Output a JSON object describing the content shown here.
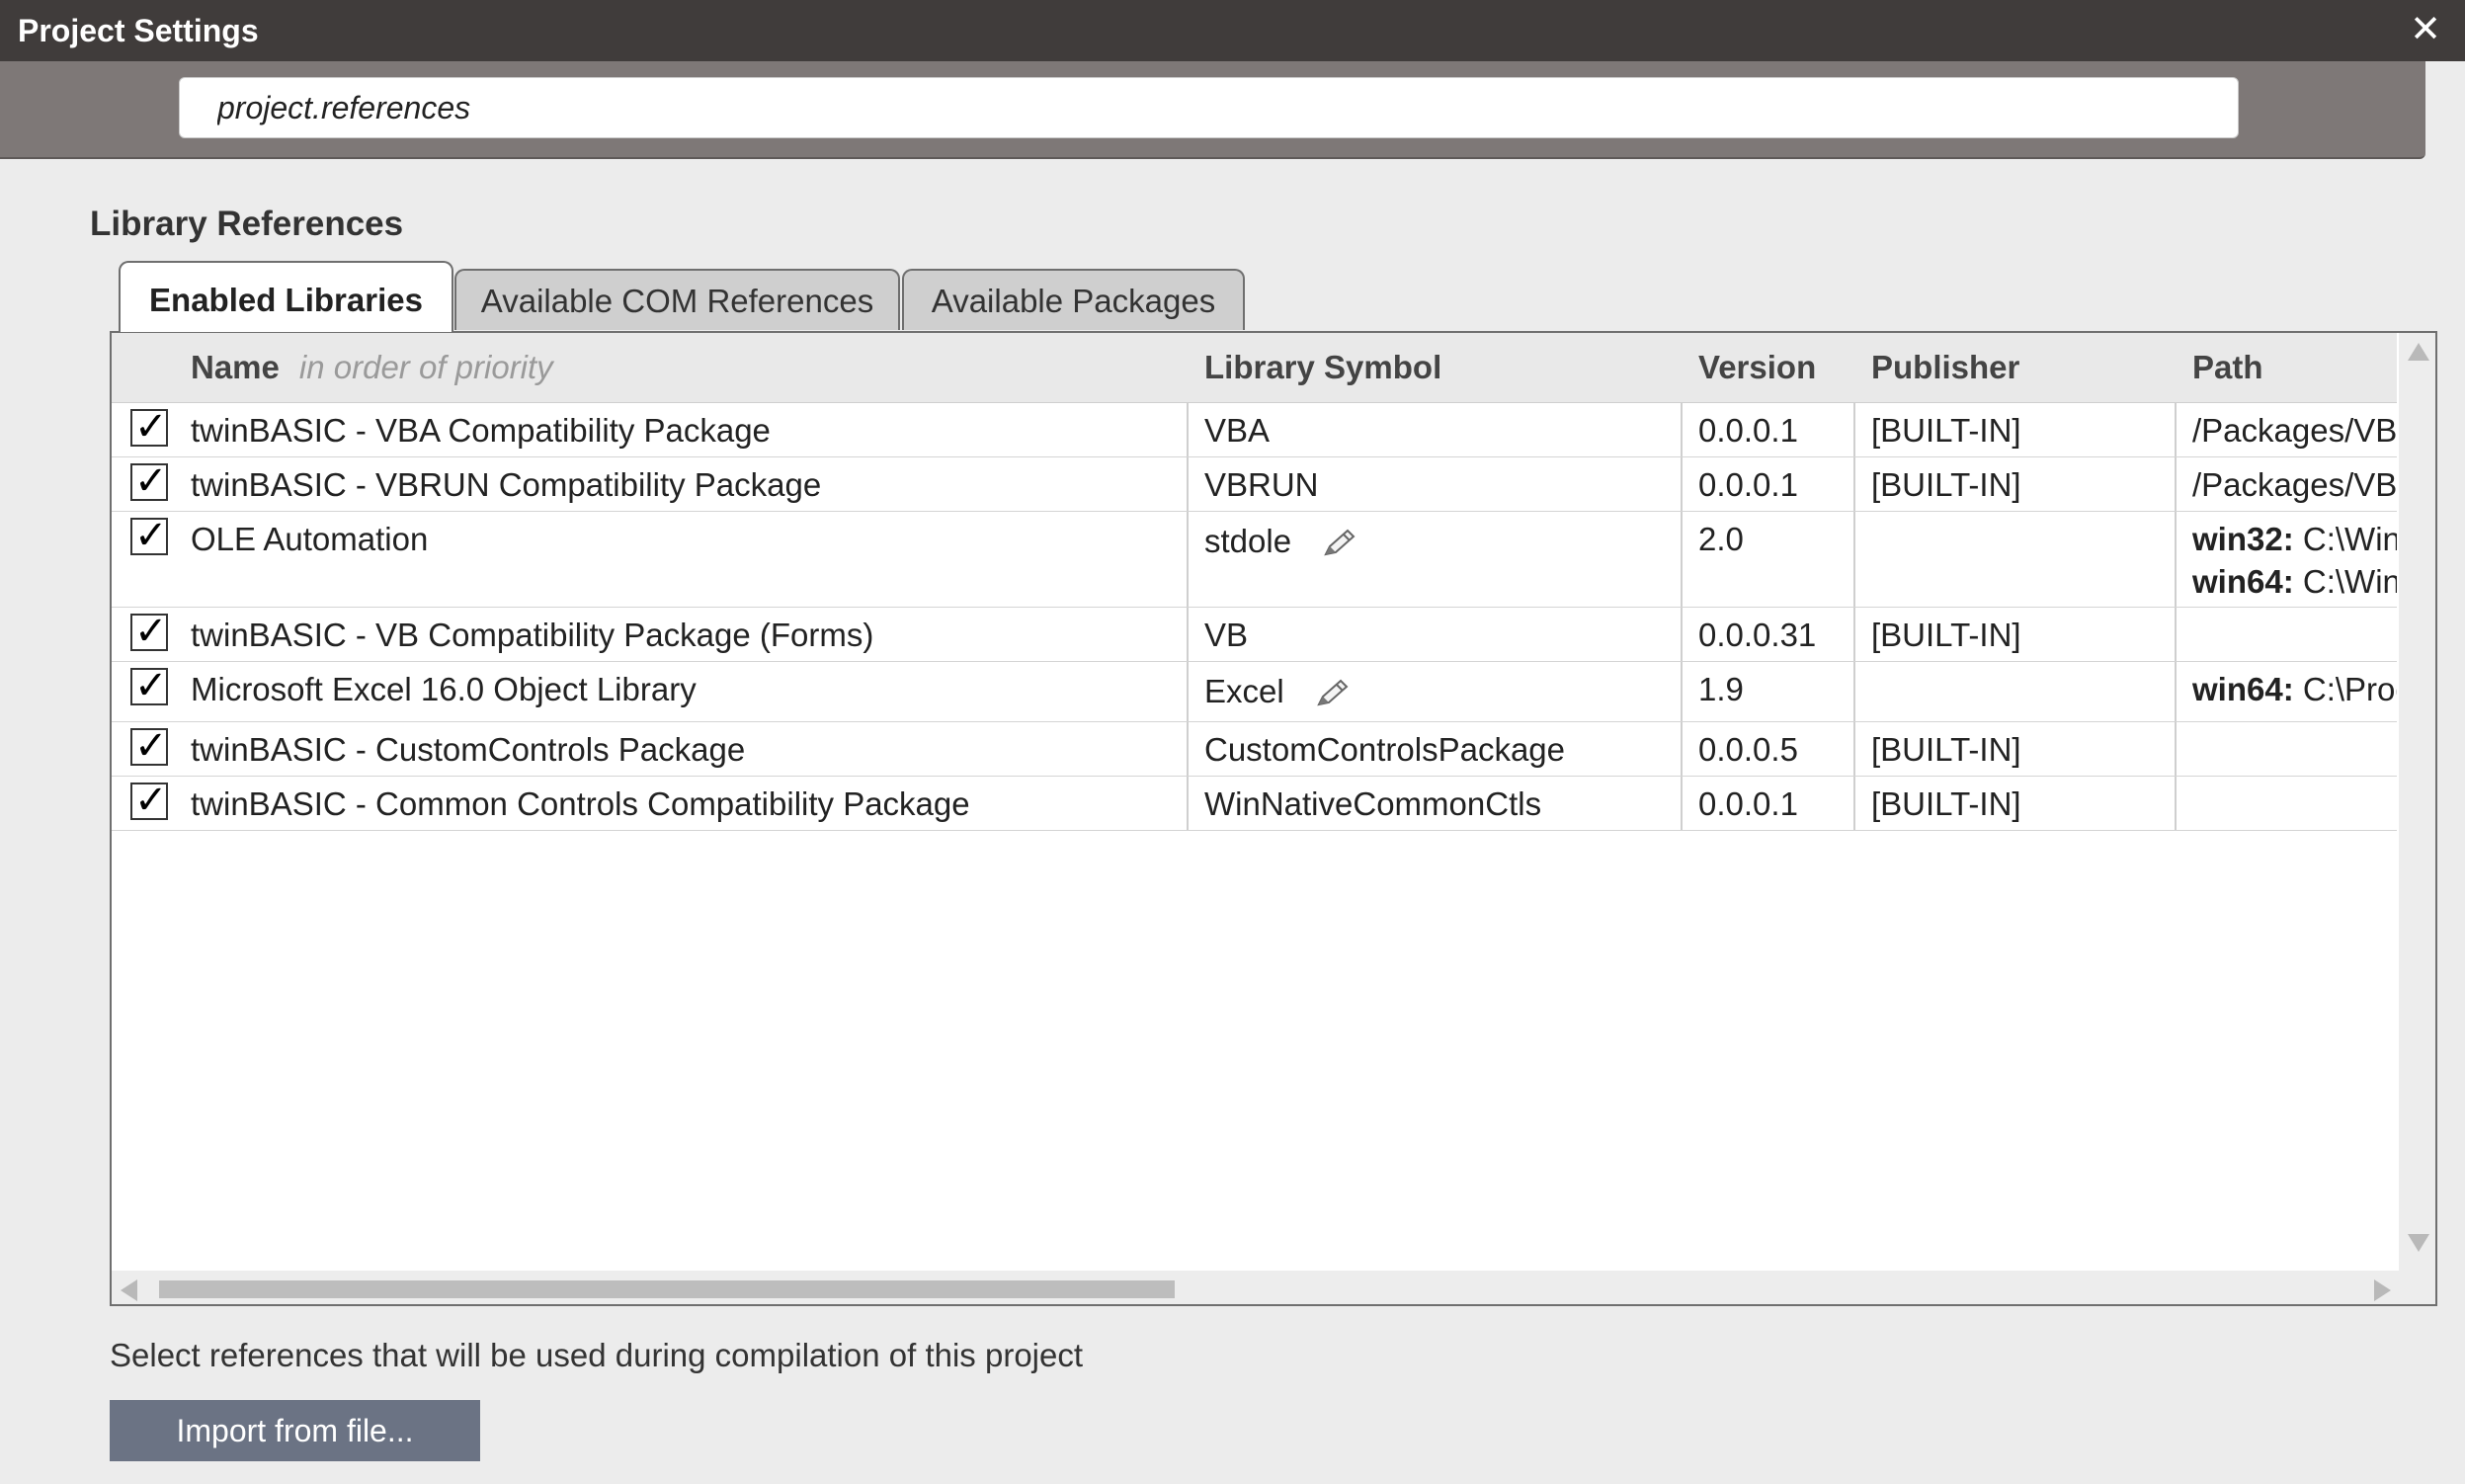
{
  "window": {
    "title": "Project Settings",
    "close_glyph": "✕"
  },
  "search": {
    "value": "project.references",
    "placeholder": ""
  },
  "section": {
    "title": "Library References"
  },
  "tabs": [
    {
      "label": "Enabled Libraries",
      "active": true
    },
    {
      "label": "Available COM References",
      "active": false
    },
    {
      "label": "Available Packages",
      "active": false
    }
  ],
  "table": {
    "columns": {
      "name": "Name",
      "name_hint": "in order of priority",
      "symbol": "Library Symbol",
      "version": "Version",
      "publisher": "Publisher",
      "path": "Path"
    },
    "rows": [
      {
        "checked": true,
        "name": "twinBASIC - VBA Compatibility Package",
        "symbol": "VBA",
        "symbol_editable": false,
        "version": "0.0.0.1",
        "publisher": "[BUILT-IN]",
        "path": "/Packages/VBA"
      },
      {
        "checked": true,
        "name": "twinBASIC - VBRUN Compatibility Package",
        "symbol": "VBRUN",
        "symbol_editable": false,
        "version": "0.0.0.1",
        "publisher": "[BUILT-IN]",
        "path": "/Packages/VBR"
      },
      {
        "checked": true,
        "name": "OLE Automation",
        "symbol": "stdole",
        "symbol_editable": true,
        "version": "2.0",
        "publisher": "",
        "path_win32_label": "win32:",
        "path_win32": "C:\\Wind",
        "path_win64_label": "win64:",
        "path_win64": "C:\\Wind"
      },
      {
        "checked": true,
        "name": "twinBASIC - VB Compatibility Package (Forms)",
        "symbol": "VB",
        "symbol_editable": false,
        "version": "0.0.0.31",
        "publisher": "[BUILT-IN]",
        "path": ""
      },
      {
        "checked": true,
        "name": "Microsoft Excel 16.0 Object Library",
        "symbol": "Excel",
        "symbol_editable": true,
        "version": "1.9",
        "publisher": "",
        "path_win64_label": "win64:",
        "path_win64": "C:\\Prog"
      },
      {
        "checked": true,
        "name": "twinBASIC - CustomControls Package",
        "symbol": "CustomControlsPackage",
        "symbol_editable": false,
        "version": "0.0.0.5",
        "publisher": "[BUILT-IN]",
        "path": ""
      },
      {
        "checked": true,
        "name": "twinBASIC - Common Controls Compatibility Package",
        "symbol": "WinNativeCommonCtls",
        "symbol_editable": false,
        "version": "0.0.0.1",
        "publisher": "[BUILT-IN]",
        "path": ""
      }
    ]
  },
  "checkmark_glyph": "✓",
  "footer": {
    "hint": "Select references that will be used during compilation of this project",
    "import_button": "Import from file..."
  },
  "colors": {
    "titlebar": "#403c3b",
    "search_band": "#7e7877",
    "import_button": "#6b7384",
    "background": "#ececec"
  }
}
